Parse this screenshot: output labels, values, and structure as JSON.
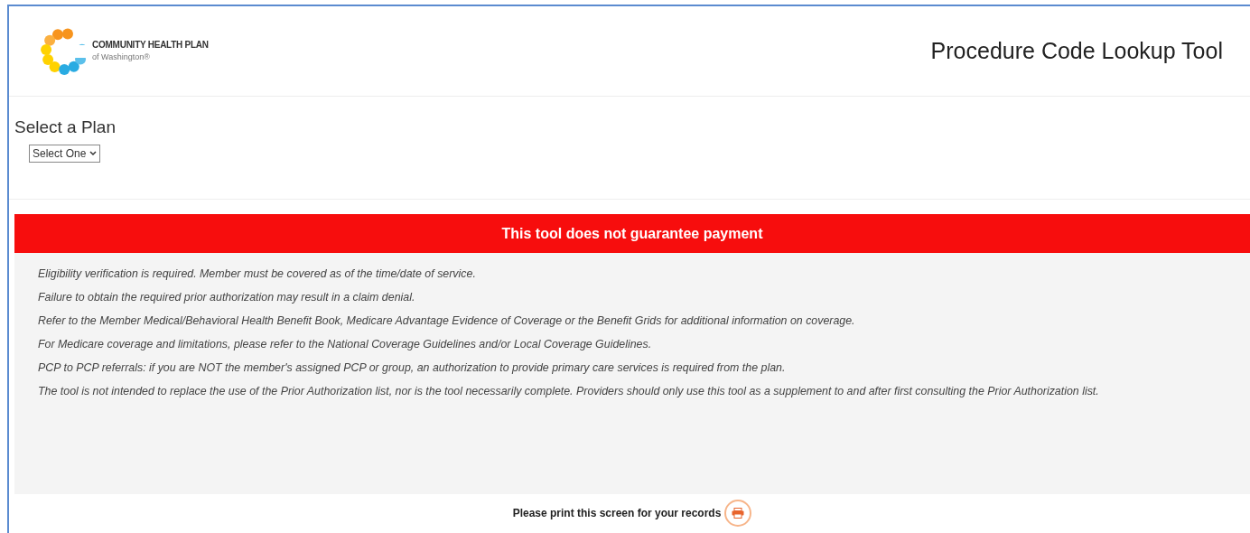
{
  "logo": {
    "name": "COMMUNITY HEALTH PLAN",
    "subtitle": "of Washington®"
  },
  "page_title": "Procedure Code Lookup Tool",
  "plan_select": {
    "label": "Select a Plan",
    "value": "Select One"
  },
  "banner": "This tool does not guarantee payment",
  "notes": [
    "Eligibility verification is required. Member must be covered as of the time/date of service.",
    "Failure to obtain the required prior authorization may result in a claim denial.",
    "Refer to the Member Medical/Behavioral Health Benefit Book, Medicare Advantage Evidence of Coverage or the Benefit Grids for additional information on coverage.",
    "For Medicare coverage and limitations, please refer to the National Coverage Guidelines and/or Local Coverage Guidelines.",
    "PCP to PCP referrals: if you are NOT the member's assigned PCP or group, an authorization to provide primary care services is required from the plan.",
    "The tool is not intended to replace the use of the Prior Authorization list, nor is the tool necessarily complete. Providers should only use this tool as a supplement to and after first consulting the Prior Authorization list."
  ],
  "print_prompt": "Please print this screen for your records"
}
